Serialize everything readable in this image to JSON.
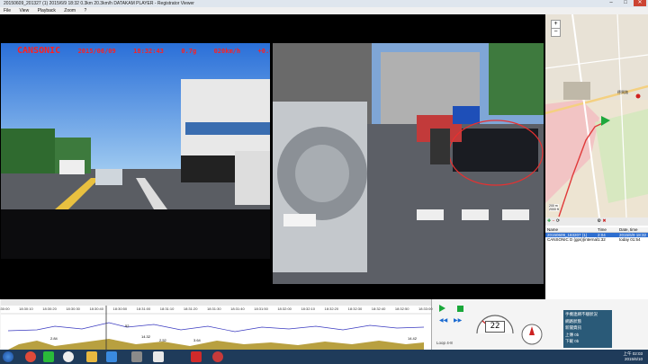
{
  "window": {
    "title": "20150609_201327 (1)  2015/6/9 18:32  0.3km  20.3km/h  DATAKAM PLAYER - Registrator Viewer",
    "controls": [
      "–",
      "□",
      "✕"
    ]
  },
  "menu": [
    "File",
    "View",
    "Playback",
    "Zoom",
    "?"
  ],
  "overlay": {
    "brand": "CANSONIC",
    "date": "2015/06/09",
    "time": "18:32:43",
    "code": "0.7g",
    "speed": "020km/h",
    "extra": "+0.075"
  },
  "gps_table": {
    "headers": [
      "Name",
      "Time",
      "Date, time"
    ],
    "rows": [
      {
        "name": "20150609_183207 (1)",
        "time": "2:04",
        "date": "2015/6/9 18:32"
      },
      {
        "name": "CANSONIC D (gps)(internal)",
        "time": "1:32",
        "date": "today 01:54"
      }
    ]
  },
  "map": {
    "zoom_in": "+",
    "zoom_out": "−",
    "scale_top": "200 m",
    "scale_bottom": "2000 ft",
    "place": "德興路"
  },
  "timeline": {
    "ticks": [
      "18:30:00",
      "18:30:10",
      "18:30:20",
      "18:30:30",
      "18:30:40",
      "18:30:50",
      "18:31:00",
      "18:31:10",
      "18:31:20",
      "18:31:30",
      "18:31:40",
      "18:31:50",
      "18:32:00",
      "18:32:10",
      "18:32:20",
      "18:32:30",
      "18:32:40",
      "18:32:50",
      "18:33:00"
    ],
    "labels": [
      "2.84",
      "52",
      "14.32",
      "2.52",
      "3.64",
      "14.42"
    ]
  },
  "controls": {
    "loop_label": "Loop 4-8",
    "speed_value": "22"
  },
  "notification": {
    "lines": [
      "手機連網不穩狀況",
      "網路狀態",
      "新聞資訊",
      "上傳",
      "下載"
    ],
    "values": [
      "",
      "0b",
      "0b",
      "0b",
      "0b"
    ]
  },
  "clock": {
    "time": "上午 02:03",
    "date": "2015/6/10"
  },
  "colors": {
    "accent": "#2f6fd0",
    "overlay_red": "#ff2020",
    "taskbar": "#1f3b5a"
  }
}
